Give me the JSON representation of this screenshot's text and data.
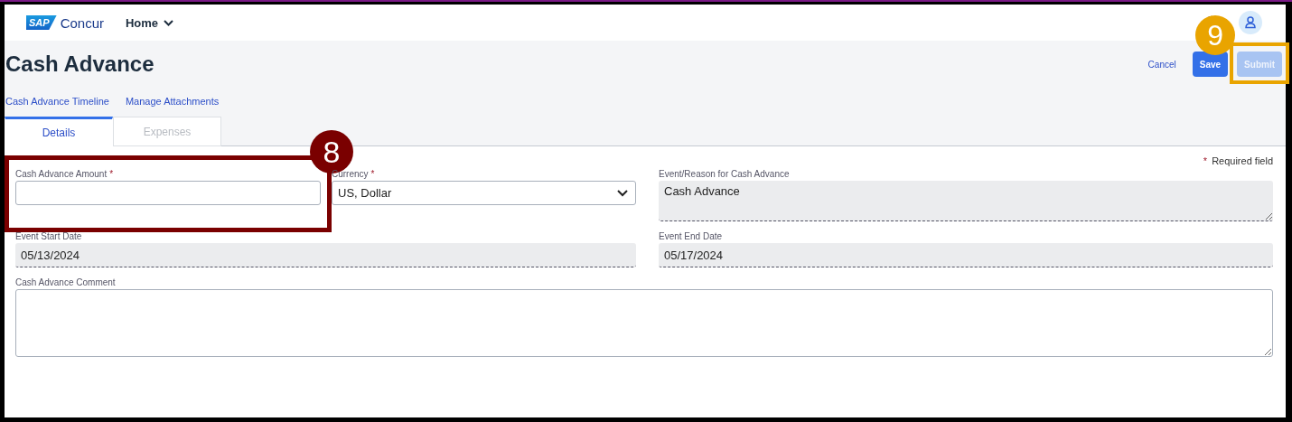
{
  "header": {
    "logo_mark": "SAP",
    "logo_text": "Concur",
    "menu": "Home"
  },
  "page": {
    "title": "Cash Advance"
  },
  "actions": [
    {
      "label": "Cancel",
      "kind": "link"
    },
    {
      "label": "Save",
      "kind": "primary",
      "disabled": false
    },
    {
      "label": "Submit",
      "kind": "primary",
      "disabled": true
    }
  ],
  "links": [
    {
      "label": "Cash Advance Timeline"
    },
    {
      "label": "Manage Attachments"
    }
  ],
  "tabs": [
    {
      "label": "Details",
      "selected": true,
      "disabled": false
    },
    {
      "label": "Expenses",
      "selected": false,
      "disabled": true
    }
  ],
  "required_note": {
    "mark": "*",
    "text": "Required field"
  },
  "fields": [
    {
      "kind": "text",
      "label": "Cash Advance Amount",
      "required": true,
      "readonly": false
    },
    {
      "kind": "select",
      "label": "Currency",
      "required": true,
      "value": "US, Dollar",
      "readonly": false
    },
    {
      "kind": "textarea",
      "label": "Event/Reason for Cash Advance",
      "required": false,
      "value": "Cash Advance",
      "readonly": true
    },
    {
      "kind": "text",
      "label": "Event Start Date",
      "required": false,
      "value": "05/13/2024",
      "readonly": true
    },
    {
      "kind": "text",
      "label": "Event End Date",
      "required": false,
      "value": "05/17/2024",
      "readonly": true
    },
    {
      "kind": "textarea",
      "label": "Cash Advance Comment",
      "required": false,
      "readonly": false
    }
  ],
  "annotations": [
    {
      "number": "8",
      "color": "#7a0000"
    },
    {
      "number": "9",
      "color": "#e9a400"
    }
  ]
}
